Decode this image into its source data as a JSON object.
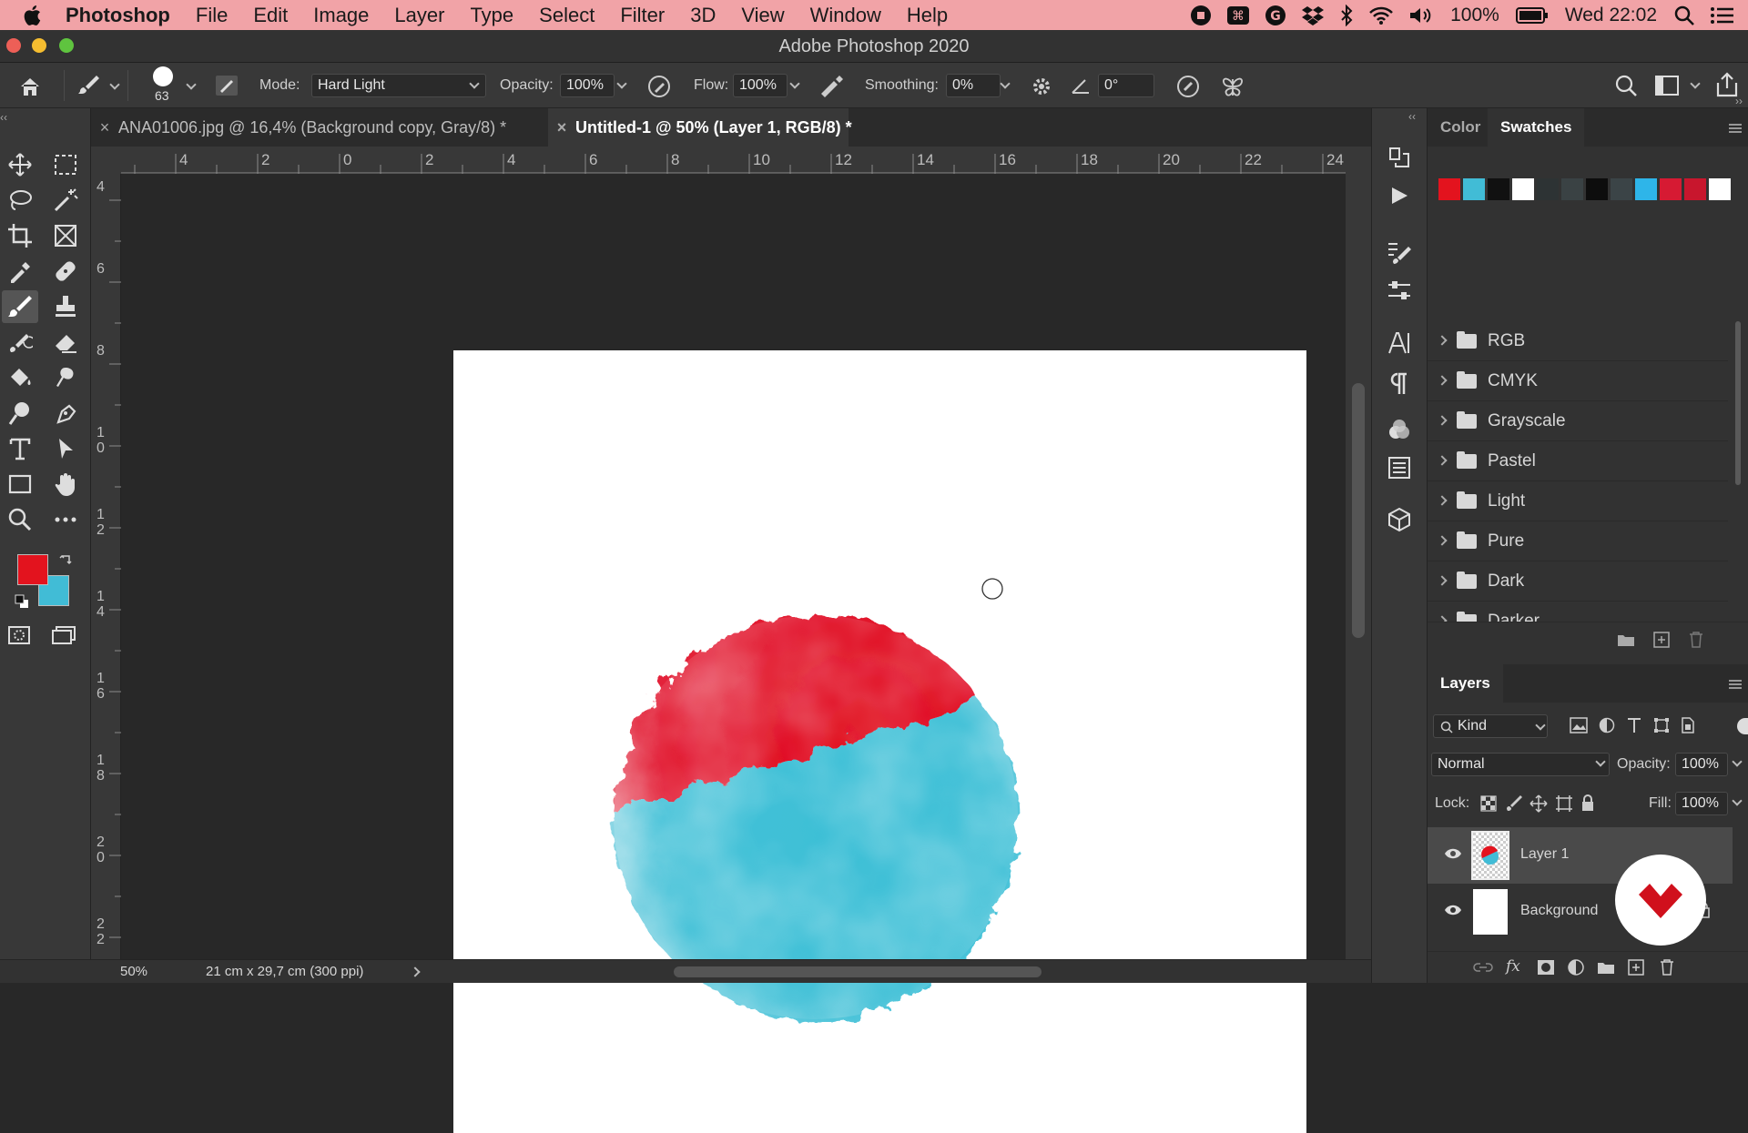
{
  "menubar": {
    "app": "Photoshop",
    "items": [
      "File",
      "Edit",
      "Image",
      "Layer",
      "Type",
      "Select",
      "Filter",
      "3D",
      "View",
      "Window",
      "Help"
    ],
    "battery": "100%",
    "clock": "Wed 22:02"
  },
  "window": {
    "title": "Adobe Photoshop 2020"
  },
  "options": {
    "brush_size": "63",
    "mode_label": "Mode:",
    "mode_value": "Hard Light",
    "opacity_label": "Opacity:",
    "opacity_value": "100%",
    "flow_label": "Flow:",
    "flow_value": "100%",
    "smoothing_label": "Smoothing:",
    "smoothing_value": "0%",
    "angle_value": "0°"
  },
  "tabs": [
    {
      "label": "ANA01006.jpg @ 16,4% (Background copy, Gray/8) *",
      "active": false
    },
    {
      "label": "Untitled-1 @ 50% (Layer 1, RGB/8) *",
      "active": true
    }
  ],
  "ruler": {
    "h_ticks": [
      "4",
      "2",
      "0",
      "2",
      "4",
      "6",
      "8",
      "10",
      "12",
      "14",
      "16",
      "18",
      "20",
      "22",
      "24"
    ],
    "v_ticks": [
      "4",
      "6",
      "8",
      "10",
      "12",
      "14",
      "16",
      "18",
      "20",
      "22"
    ]
  },
  "colors": {
    "foreground": "#e3131e",
    "background": "#41bcd6"
  },
  "status": {
    "zoom": "50%",
    "doc_info": "21 cm x 29,7 cm (300 ppi)"
  },
  "swatches_panel": {
    "tabs": [
      "Color",
      "Swatches"
    ],
    "active_tab": "Swatches",
    "swatch_colors": [
      "#e3131e",
      "#41bcd6",
      "#111111",
      "#ffffff",
      "#2d3334",
      "#3a4244",
      "#0d0d0d",
      "#3b4447",
      "#2eb5e9",
      "#d61a33",
      "#c8162d",
      "#ffffff"
    ],
    "groups": [
      "RGB",
      "CMYK",
      "Grayscale",
      "Pastel",
      "Light",
      "Pure",
      "Dark",
      "Darker"
    ]
  },
  "layers_panel": {
    "tab": "Layers",
    "filter_kind": "Kind",
    "blend_mode": "Normal",
    "opacity_label": "Opacity:",
    "opacity_value": "100%",
    "lock_label": "Lock:",
    "fill_label": "Fill:",
    "fill_value": "100%",
    "layers": [
      {
        "name": "Layer 1",
        "selected": true
      },
      {
        "name": "Background",
        "locked": true
      }
    ]
  }
}
